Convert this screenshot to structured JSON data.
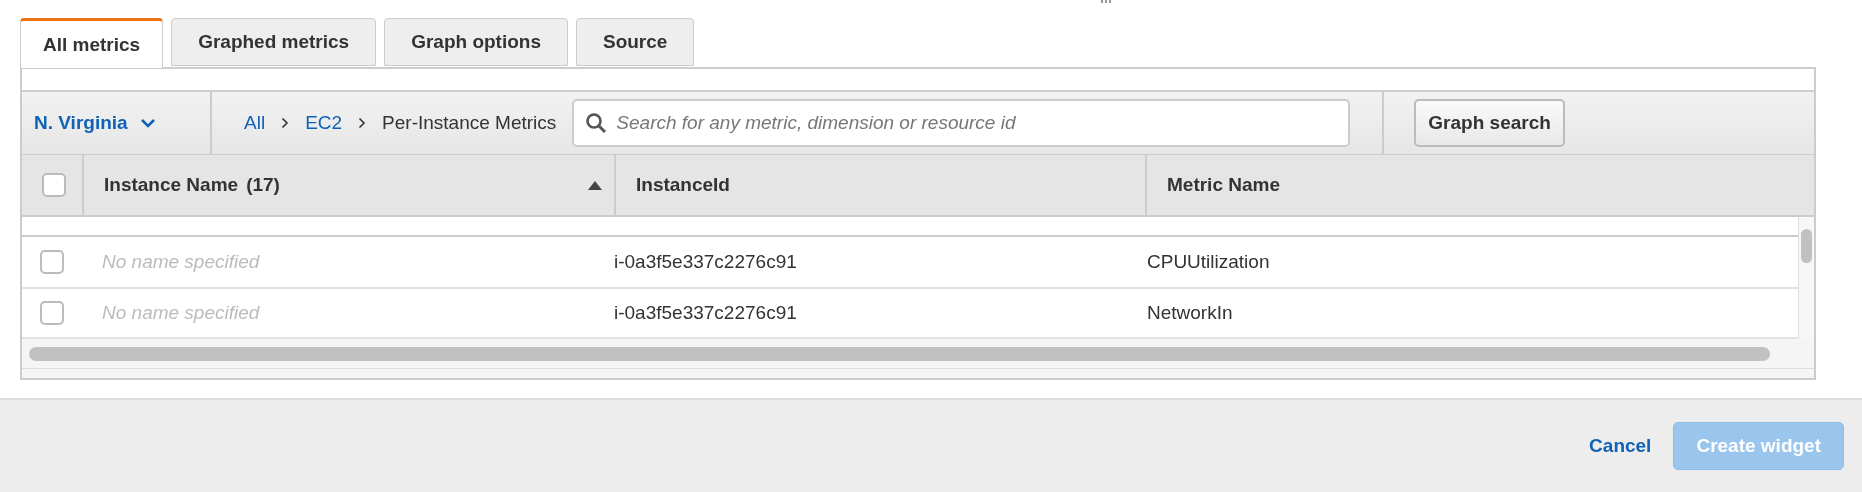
{
  "tabs": [
    {
      "label": "All metrics",
      "selected": true
    },
    {
      "label": "Graphed metrics",
      "selected": false
    },
    {
      "label": "Graph options",
      "selected": false
    },
    {
      "label": "Source",
      "selected": false
    }
  ],
  "region": {
    "label": "N. Virginia"
  },
  "breadcrumb": [
    {
      "label": "All",
      "kind": "link"
    },
    {
      "label": "EC2",
      "kind": "link"
    },
    {
      "label": "Per-Instance Metrics",
      "kind": "current"
    }
  ],
  "search": {
    "placeholder": "Search for any metric, dimension or resource id"
  },
  "graph_search_button": "Graph search",
  "table": {
    "columns": [
      {
        "label": "Instance Name",
        "count": "(17)",
        "sorted": true
      },
      {
        "label": "InstanceId",
        "sorted": false
      },
      {
        "label": "Metric Name",
        "sorted": false
      }
    ],
    "all_checked": false,
    "rows": [
      {
        "checked": false,
        "instance_name": "No name specified",
        "instance_id": "i-0a3f5e337c2276c91",
        "metric_name": "CPUUtilization"
      },
      {
        "checked": false,
        "instance_name": "No name specified",
        "instance_id": "i-0a3f5e337c2276c91",
        "metric_name": "NetworkIn"
      }
    ]
  },
  "footer": {
    "cancel": "Cancel",
    "create": {
      "label": "Create widget",
      "disabled": true
    }
  }
}
